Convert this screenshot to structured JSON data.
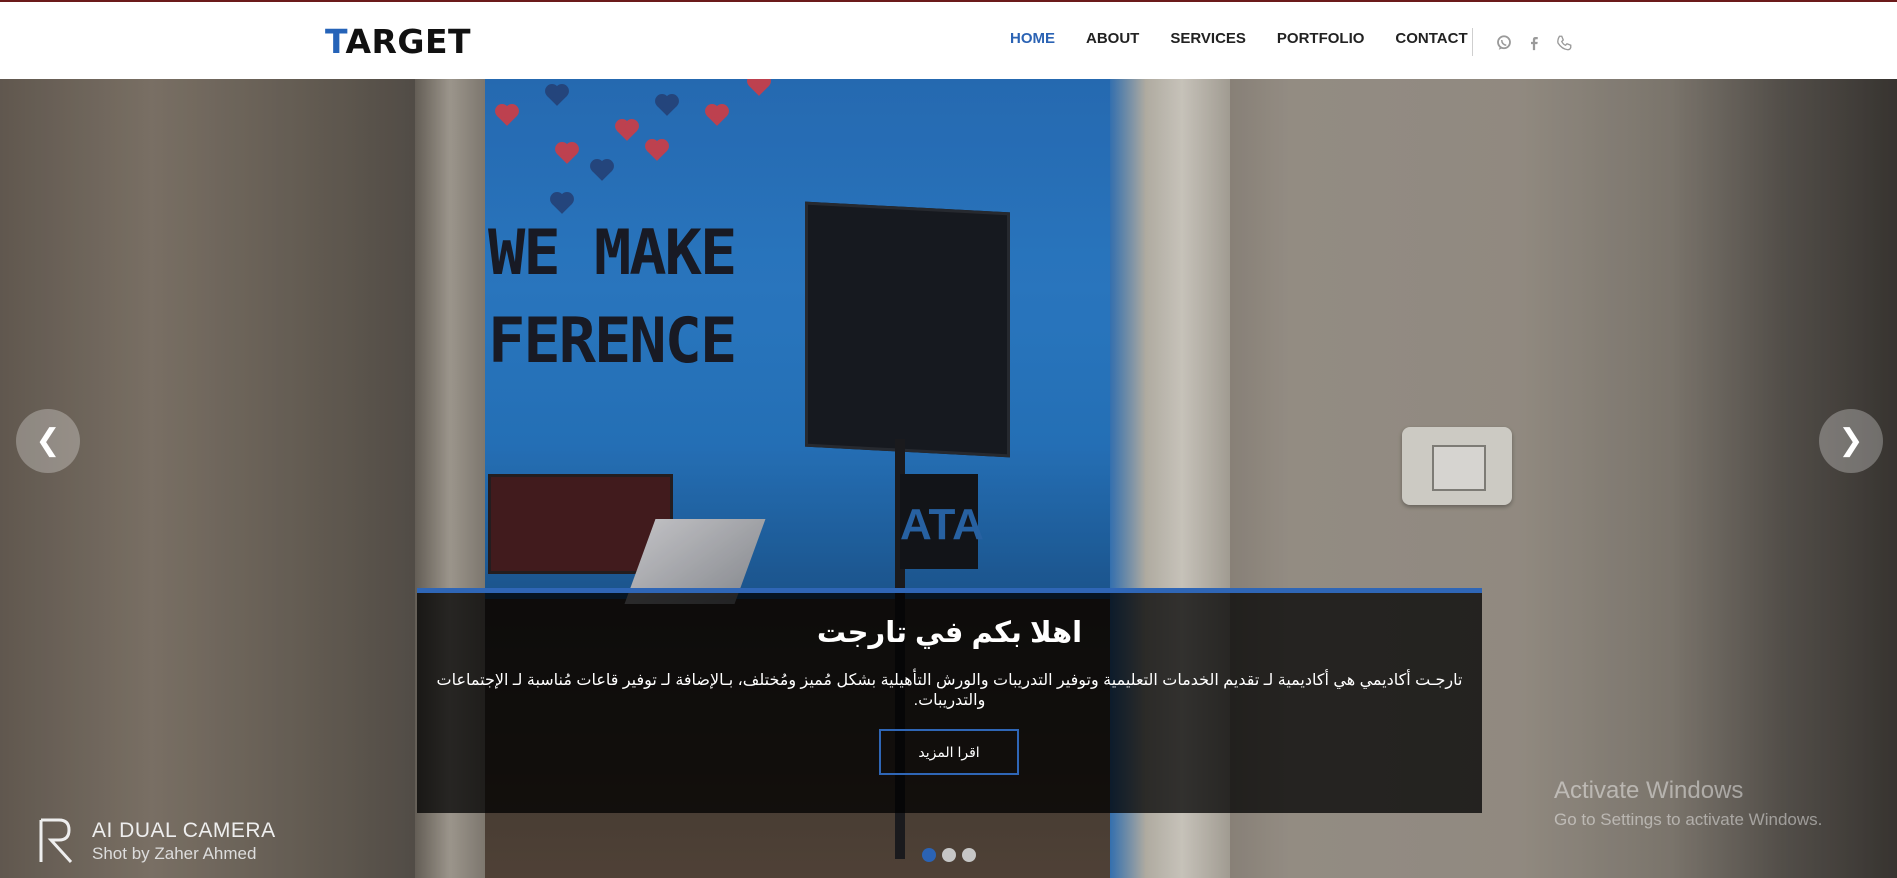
{
  "brand": {
    "logo_first": "T",
    "logo_rest": "ARGET"
  },
  "nav": {
    "items": [
      {
        "label": "HOME",
        "active": true
      },
      {
        "label": "ABOUT",
        "active": false
      },
      {
        "label": "SERVICES",
        "active": false
      },
      {
        "label": "PORTFOLIO",
        "active": false
      },
      {
        "label": "CONTACT",
        "active": false
      }
    ],
    "social_icons": [
      "whatsapp-icon",
      "facebook-icon",
      "phone-icon"
    ]
  },
  "hero": {
    "wall_text_line1": "WE MAKE",
    "wall_text_line2": "FERENCE",
    "sign_text": "ATA",
    "caption_title": "اهلا بكم في تارجت",
    "caption_text": "تارجـت أكاديمي هي أكاديمية لـ تقديم الخدمات التعليمية وتوفير التدريبات والورش التأهيلية بشكل مُميز ومُختلف، بـالإضافة لـ توفير قاعات مُناسبة لـ الإجتماعات والتدريبات.",
    "button_label": "اقرا المزيد",
    "prev_icon": "chevron-left-icon",
    "next_icon": "chevron-right-icon",
    "slides_count": 3,
    "active_slide": 1
  },
  "watermark": {
    "camera_line1": "AI DUAL CAMERA",
    "camera_line2": "Shot by Zaher Ahmed",
    "activate_title": "Activate Windows",
    "activate_sub": "Go to Settings to activate Windows."
  },
  "colors": {
    "accent": "#2b63b4",
    "topline": "#6b1a1a",
    "caption_bg": "rgba(0,0,0,0.75)"
  }
}
